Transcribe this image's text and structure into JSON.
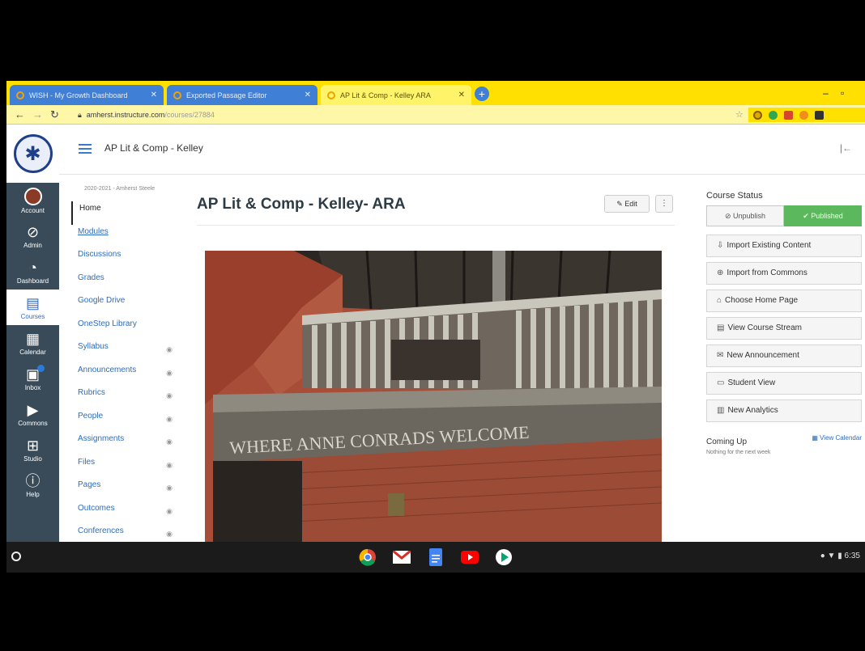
{
  "browser": {
    "tabs": [
      {
        "label": "WISH - My Growth Dashboard"
      },
      {
        "label": "Exported Passage Editor"
      },
      {
        "label": "AP Lit & Comp - Kelley ARA"
      }
    ],
    "url_host": "amherst.instructure.com",
    "url_path": "/courses/27884"
  },
  "global_nav": [
    {
      "label": "Account",
      "icon": "avatar"
    },
    {
      "label": "Admin",
      "icon": "shield-icon"
    },
    {
      "label": "Dashboard",
      "icon": "dashboard-icon"
    },
    {
      "label": "Courses",
      "icon": "book-icon"
    },
    {
      "label": "Calendar",
      "icon": "calendar-icon"
    },
    {
      "label": "Inbox",
      "icon": "inbox-icon"
    },
    {
      "label": "Commons",
      "icon": "commons-icon"
    },
    {
      "label": "Studio",
      "icon": "studio-icon"
    },
    {
      "label": "Help",
      "icon": "help-icon"
    }
  ],
  "header": {
    "breadcrumb": "AP Lit & Comp - Kelley"
  },
  "course_nav": {
    "term": "2020-2021 - Amherst Steele",
    "items": [
      {
        "label": "Home",
        "hidden": false
      },
      {
        "label": "Modules",
        "hidden": false
      },
      {
        "label": "Discussions",
        "hidden": false
      },
      {
        "label": "Grades",
        "hidden": false
      },
      {
        "label": "Google Drive",
        "hidden": false
      },
      {
        "label": "OneStep Library",
        "hidden": false
      },
      {
        "label": "Syllabus",
        "hidden": true
      },
      {
        "label": "Announcements",
        "hidden": true
      },
      {
        "label": "Rubrics",
        "hidden": true
      },
      {
        "label": "People",
        "hidden": true
      },
      {
        "label": "Assignments",
        "hidden": true
      },
      {
        "label": "Files",
        "hidden": true
      },
      {
        "label": "Pages",
        "hidden": true
      },
      {
        "label": "Outcomes",
        "hidden": true
      },
      {
        "label": "Conferences",
        "hidden": true
      }
    ]
  },
  "main": {
    "title": "AP Lit & Comp - Kelley- ARA",
    "edit_label": "Edit",
    "more_label": "⋮",
    "image_sign_text": "WHERE ANNE CONRADS WELCOME"
  },
  "sidebar": {
    "course_status": "Course Status",
    "unpublish_label": "Unpublish",
    "published_label": "Published",
    "buttons": [
      {
        "label": "Import Existing Content",
        "icon": "import-icon"
      },
      {
        "label": "Import from Commons",
        "icon": "commons-icon"
      },
      {
        "label": "Choose Home Page",
        "icon": "home-icon"
      },
      {
        "label": "View Course Stream",
        "icon": "stream-icon"
      },
      {
        "label": "New Announcement",
        "icon": "announcement-icon"
      },
      {
        "label": "Student View",
        "icon": "student-view-icon"
      },
      {
        "label": "New Analytics",
        "icon": "analytics-icon"
      }
    ],
    "coming_up": "Coming Up",
    "view_calendar": "View Calendar",
    "nothing": "Nothing for the next week"
  },
  "shelf": {
    "time": "6:35"
  },
  "colors": {
    "tab_strip": "#ffe000",
    "canvas_nav": "#394b58",
    "link": "#2d6cb8",
    "published": "#5cb85c"
  }
}
